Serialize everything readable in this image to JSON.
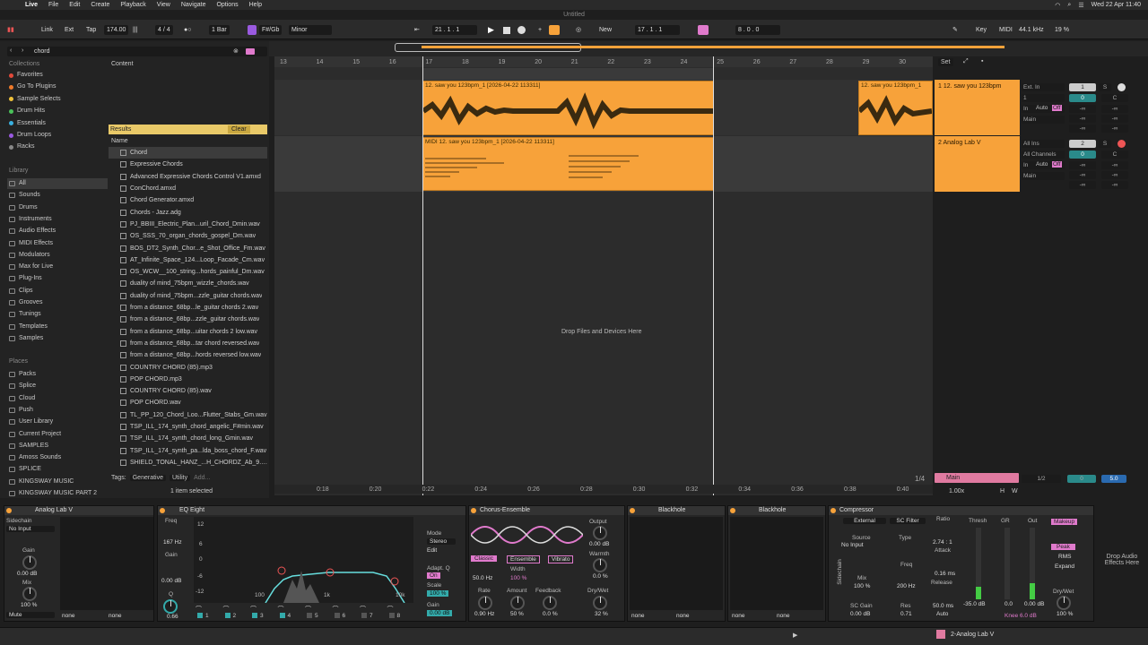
{
  "menubar": {
    "app": "Live",
    "items": [
      "File",
      "Edit",
      "Create",
      "Playback",
      "View",
      "Navigate",
      "Options",
      "Help"
    ],
    "datetime": "Wed 22 Apr 11:40"
  },
  "window": {
    "title": "Untitled"
  },
  "transport": {
    "link": "Link",
    "ext": "Ext",
    "tap": "Tap",
    "tempo": "174.00",
    "signature": "4 / 4",
    "quantize": "1 Bar",
    "key": "F#/Gb",
    "scale": "Minor",
    "position": "21 .  1 .  1",
    "new_label": "New",
    "loop_start": "17 .  1 .  1",
    "loop_length": "8 .  0 .  0",
    "key_label": "Key",
    "midi_label": "MIDI",
    "sample_rate": "44.1 kHz",
    "cpu": "19 %"
  },
  "browser": {
    "search": "chord",
    "content_label": "Content",
    "collections_title": "Collections",
    "collections": [
      {
        "label": "Favorites",
        "color": "#e24a3a"
      },
      {
        "label": "Go To Plugins",
        "color": "#f07a2a"
      },
      {
        "label": "Sample Selects",
        "color": "#f0c23a"
      },
      {
        "label": "Drum Hits",
        "color": "#4ac25a"
      },
      {
        "label": "Essentials",
        "color": "#3ab0e0"
      },
      {
        "label": "Drum Loops",
        "color": "#9a5ae0"
      },
      {
        "label": "Racks",
        "color": "#888888"
      }
    ],
    "library_title": "Library",
    "library": [
      "All",
      "Sounds",
      "Drums",
      "Instruments",
      "Audio Effects",
      "MIDI Effects",
      "Modulators",
      "Max for Live",
      "Plug-Ins",
      "Clips",
      "Grooves",
      "Tunings",
      "Templates",
      "Samples"
    ],
    "places_title": "Places",
    "places": [
      "Packs",
      "Splice",
      "Cloud",
      "Push",
      "User Library",
      "Current Project",
      "SAMPLES",
      "Amoss Sounds",
      "SPLICE",
      "KINGSWAY MUSIC",
      "KINGSWAY MUSIC PART 2"
    ],
    "results_label": "Results",
    "clear_label": "Clear",
    "name_header": "Name",
    "results": [
      "Chord",
      "Expressive Chords",
      "Advanced Expressive Chords Control V1.amxd",
      "ConChord.amxd",
      "Chord Generator.amxd",
      "Chords - Jazz.adg",
      "PJ_BBIII_Electric_Plan...uril_Chord_Dmin.wav",
      "OS_SSS_70_organ_chords_gospel_Dm.wav",
      "BOS_DT2_Synth_Chor...e_Shot_Office_Fm.wav",
      "AT_Infinite_Space_124...Loop_Facade_Cm.wav",
      "OS_WCW__100_string...hords_painful_Dm.wav",
      "duality of mind_75bpm_wizzle_chords.wav",
      "duality of mind_75bpm...zzle_guitar chords.wav",
      "from a distance_68bp...le_guitar chords 2.wav",
      "from a distance_68bp...zzle_guitar chords.wav",
      "from a distance_68bp...uitar chords 2 low.wav",
      "from a distance_68bp...tar chord reversed.wav",
      "from a distance_68bp...hords reversed low.wav",
      "COUNTRY CHORD (85).mp3",
      "POP CHORD.mp3",
      "COUNTRY CHORD (85).wav",
      "POP CHORD.wav",
      "TL_PP_120_Chord_Loo...Flutter_Stabs_Gm.wav",
      "TSP_ILL_174_synth_chord_angelic_F#min.wav",
      "TSP_ILL_174_synth_chord_long_Gmin.wav",
      "TSP_ILL_174_synth_pa...lda_boss_chord_F.wav",
      "SHIELD_TONAL_HANZ_...H_CHORDZ_Ab_9.wav"
    ],
    "tags_label": "Tags:",
    "tags": [
      "Generative",
      "Utility",
      "Add..."
    ],
    "selected_status": "1 item selected"
  },
  "arrangement": {
    "ruler": [
      "13",
      "14",
      "15",
      "16",
      "17",
      "18",
      "19",
      "20",
      "21",
      "22",
      "23",
      "24",
      "25",
      "26",
      "27",
      "28",
      "29",
      "30"
    ],
    "time_ruler": [
      "0:18",
      "0:20",
      "0:22",
      "0:24",
      "0:26",
      "0:28",
      "0:30",
      "0:32",
      "0:34",
      "0:36",
      "0:38",
      "0:40"
    ],
    "set_label": "Set",
    "clip1": "12. saw you 123bpm_1 [2026-04-22 113311]",
    "clip1b": "12. saw you 123bpm_1",
    "clip2": "MIDI 12. saw you 123bpm_1 [2026-04-22 113311]",
    "drop_hint": "Drop Files and Devices Here",
    "zoom": "1/4",
    "tracks": [
      {
        "name": "1 12. saw you 123bpm",
        "input": "Ext. In",
        "ch": "1",
        "mon_in": "In",
        "mon_auto": "Auto",
        "mon_off": "Off",
        "out": "Main",
        "num": "1",
        "s": "S",
        "vol": "0",
        "pan": "C",
        "sends": [
          "-∞",
          "-∞",
          "-∞",
          "-∞",
          "-∞",
          "-∞"
        ]
      },
      {
        "name": "2 Analog Lab V",
        "input": "All Ins",
        "ch": "All Channels",
        "mon_in": "In",
        "mon_auto": "Auto",
        "mon_off": "Off",
        "out": "Main",
        "num": "2",
        "s": "S",
        "vol": "0",
        "pan": "C",
        "sends": [
          "-∞",
          "-∞",
          "-∞",
          "-∞",
          "-∞",
          "-∞"
        ]
      }
    ],
    "main": {
      "name": "Main",
      "speed": "1.00x",
      "sends": "1/2",
      "vol": "0",
      "val": "5.0",
      "h": "H",
      "w": "W"
    }
  },
  "devices": {
    "analog_lab": {
      "title": "Analog Lab V",
      "sidechain": "Sidechain",
      "sc_input": "No Input",
      "gain_label": "Gain",
      "gain": "0.00 dB",
      "mix_label": "Mix",
      "mix": "100 %",
      "mute": "Mute",
      "none1": "none",
      "none2": "none"
    },
    "eq8": {
      "title": "EQ Eight",
      "freq_label": "Freq",
      "freq": "167 Hz",
      "gain_label": "Gain",
      "gain": "0.00 dB",
      "q_label": "Q",
      "q": "0.66",
      "mode_label": "Mode",
      "mode": "Stereo",
      "edit": "Edit",
      "adapt_label": "Adapt. Q",
      "adapt": "On",
      "scale_label": "Scale",
      "scale": "100 %",
      "out_gain_label": "Gain",
      "out_gain": "0.00 dB",
      "db_ticks": [
        "12",
        "6",
        "0",
        "-6",
        "-12"
      ],
      "hz_ticks": [
        "100",
        "1k",
        "10k"
      ],
      "bands": [
        "1",
        "2",
        "3",
        "4",
        "5",
        "6",
        "7",
        "8"
      ]
    },
    "chorus": {
      "title": "Chorus-Ensemble",
      "modes": [
        "Classic",
        "Ensemble",
        "Vibrato"
      ],
      "freq": "50.0 Hz",
      "width_label": "Width",
      "width": "100 %",
      "output_label": "Output",
      "output": "0.00 dB",
      "warmth_label": "Warmth",
      "warmth": "0.0 %",
      "rate_label": "Rate",
      "rate": "0.90 Hz",
      "amount_label": "Amount",
      "amount": "50 %",
      "feedback_label": "Feedback",
      "feedback": "0.0 %",
      "drywet_label": "Dry/Wet",
      "drywet": "32 %"
    },
    "blackhole1": {
      "title": "Blackhole",
      "none1": "none",
      "none2": "none"
    },
    "blackhole2": {
      "title": "Blackhole",
      "none1": "none",
      "none2": "none"
    },
    "compressor": {
      "title": "Compressor",
      "sidechain": "Sidechain",
      "external": "External",
      "sc_filter": "SC Filter",
      "source_label": "Source",
      "source": "No Input",
      "type_label": "Type",
      "mix_label": "Mix",
      "mix": "100 %",
      "freq_label": "Freq",
      "freq": "200 Hz",
      "sc_gain_label": "SC Gain",
      "sc_gain": "0.00 dB",
      "res_label": "Res",
      "res": "0.71",
      "ratio_label": "Ratio",
      "ratio": "2.74 : 1",
      "attack_label": "Attack",
      "attack": "0.16 ms",
      "release_label": "Release",
      "release": "50.0 ms",
      "auto": "Auto",
      "thresh_label": "Thresh",
      "gr_label": "GR",
      "out_label": "Out",
      "thresh": "-35.0 dB",
      "gr": "0.0",
      "out": "0.00 dB",
      "knee": "Knee 6.0 dB",
      "makeup": "Makeup",
      "peak": "Peak",
      "rms": "RMS",
      "expand": "Expand",
      "drywet_label": "Dry/Wet",
      "drywet": "100 %"
    },
    "drop_hint": "Drop Audio Effects Here"
  },
  "statusbar": {
    "track": "2-Analog Lab V"
  }
}
